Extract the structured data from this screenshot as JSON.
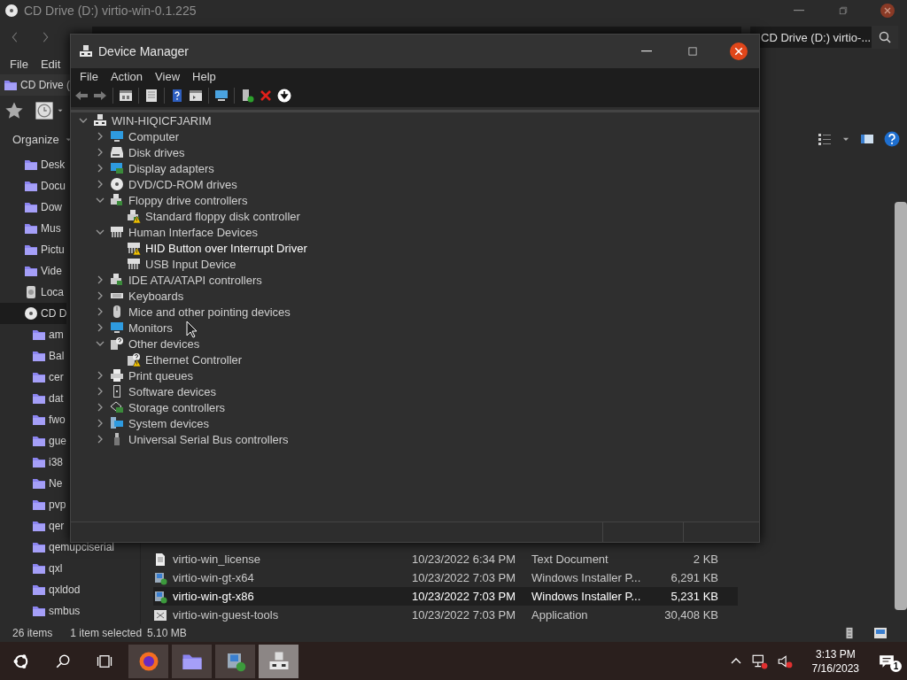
{
  "explorer": {
    "title": "CD Drive (D:) virtio-win-0.1.225",
    "search": {
      "value": "CD Drive (D:) virtio-..."
    },
    "menu": [
      "File",
      "Edit"
    ],
    "tab": "CD Drive (",
    "organize": "Organize",
    "sidebar": {
      "items": [
        {
          "label": "Desk",
          "kind": "folder",
          "selected": false
        },
        {
          "label": "Docu",
          "kind": "folder",
          "selected": false
        },
        {
          "label": "Dow",
          "kind": "folder",
          "selected": false
        },
        {
          "label": "Mus",
          "kind": "folder",
          "selected": false
        },
        {
          "label": "Pictu",
          "kind": "folder",
          "selected": false
        },
        {
          "label": "Vide",
          "kind": "folder",
          "selected": false
        },
        {
          "label": "Loca",
          "kind": "drive",
          "selected": false
        },
        {
          "label": "CD D",
          "kind": "disc",
          "selected": true,
          "children": [
            {
              "label": "am",
              "kind": "folder",
              "selected": false
            },
            {
              "label": "Bal",
              "kind": "folder",
              "selected": false
            },
            {
              "label": "cer",
              "kind": "folder",
              "selected": false
            },
            {
              "label": "dat",
              "kind": "folder",
              "selected": false
            },
            {
              "label": "fwo",
              "kind": "folder",
              "selected": false
            },
            {
              "label": "gue",
              "kind": "folder",
              "selected": false
            },
            {
              "label": "i38",
              "kind": "folder",
              "selected": false
            },
            {
              "label": "Ne",
              "kind": "folder",
              "selected": false
            },
            {
              "label": "pvp",
              "kind": "folder",
              "selected": false
            },
            {
              "label": "qer",
              "kind": "folder",
              "selected": false
            },
            {
              "label": "qemupciserial",
              "kind": "folder",
              "selected": false
            },
            {
              "label": "qxl",
              "kind": "folder",
              "selected": false
            },
            {
              "label": "qxldod",
              "kind": "folder",
              "selected": false
            },
            {
              "label": "smbus",
              "kind": "folder",
              "selected": false
            }
          ]
        }
      ]
    },
    "files": {
      "rows": [
        {
          "name": "virtio-win_license",
          "kind": "text",
          "date": "10/23/2022 6:34 PM",
          "type": "Text Document",
          "size": "2 KB",
          "selected": false
        },
        {
          "name": "virtio-win-gt-x64",
          "kind": "installer",
          "date": "10/23/2022 7:03 PM",
          "type": "Windows Installer P...",
          "size": "6,291 KB",
          "selected": false
        },
        {
          "name": "virtio-win-gt-x86",
          "kind": "installer",
          "date": "10/23/2022 7:03 PM",
          "type": "Windows Installer P...",
          "size": "5,231 KB",
          "selected": true
        },
        {
          "name": "virtio-win-guest-tools",
          "kind": "application",
          "date": "10/23/2022 7:03 PM",
          "type": "Application",
          "size": "30,408 KB",
          "selected": false
        }
      ]
    },
    "status_bar": {
      "count": "26 items",
      "selection": "1 item selected",
      "size": "5.10 MB"
    }
  },
  "device_manager": {
    "title": "Device Manager",
    "menu": [
      "File",
      "Action",
      "View",
      "Help"
    ],
    "tree": {
      "label": "WIN-HIQICFJARIM",
      "kind": "computer",
      "expanded": true,
      "selected": false,
      "children": [
        {
          "label": "Computer",
          "kind": "monitor",
          "expanded": false,
          "selected": false
        },
        {
          "label": "Disk drives",
          "kind": "disk",
          "expanded": false,
          "selected": false
        },
        {
          "label": "Display adapters",
          "kind": "display-adapter",
          "expanded": false,
          "selected": false
        },
        {
          "label": "DVD/CD-ROM drives",
          "kind": "disc",
          "expanded": false,
          "selected": false
        },
        {
          "label": "Floppy drive controllers",
          "kind": "controller",
          "expanded": true,
          "selected": false,
          "children": [
            {
              "label": "Standard floppy disk controller",
              "kind": "controller",
              "warning": true,
              "selected": false
            }
          ]
        },
        {
          "label": "Human Interface Devices",
          "kind": "hid",
          "expanded": true,
          "selected": false,
          "children": [
            {
              "label": "HID Button over Interrupt Driver",
              "kind": "hid",
              "warning": true,
              "selected": true
            },
            {
              "label": "USB Input Device",
              "kind": "hid",
              "warning": false,
              "selected": false
            }
          ]
        },
        {
          "label": "IDE ATA/ATAPI controllers",
          "kind": "controller",
          "expanded": false,
          "selected": false
        },
        {
          "label": "Keyboards",
          "kind": "keyboard",
          "expanded": false,
          "selected": false
        },
        {
          "label": "Mice and other pointing devices",
          "kind": "mouse",
          "expanded": false,
          "selected": false
        },
        {
          "label": "Monitors",
          "kind": "monitor",
          "expanded": false,
          "selected": false
        },
        {
          "label": "Other devices",
          "kind": "unknown",
          "expanded": true,
          "selected": false,
          "children": [
            {
              "label": "Ethernet Controller",
              "kind": "unknown",
              "warning": true,
              "selected": false
            }
          ]
        },
        {
          "label": "Print queues",
          "kind": "printer",
          "expanded": false,
          "selected": false
        },
        {
          "label": "Software devices",
          "kind": "software",
          "expanded": false,
          "selected": false
        },
        {
          "label": "Storage controllers",
          "kind": "storage",
          "expanded": false,
          "selected": false
        },
        {
          "label": "System devices",
          "kind": "system",
          "expanded": false,
          "selected": false
        },
        {
          "label": "Universal Serial Bus controllers",
          "kind": "usb",
          "expanded": false,
          "selected": false
        }
      ]
    }
  },
  "taskbar": {
    "apps": [
      {
        "kind": "browser",
        "active": false
      },
      {
        "kind": "explorer",
        "active": false
      },
      {
        "kind": "installer",
        "active": false
      },
      {
        "kind": "device-manager",
        "active": true
      }
    ],
    "time": "3:13 PM",
    "date": "7/16/2023",
    "notifications": "1"
  }
}
